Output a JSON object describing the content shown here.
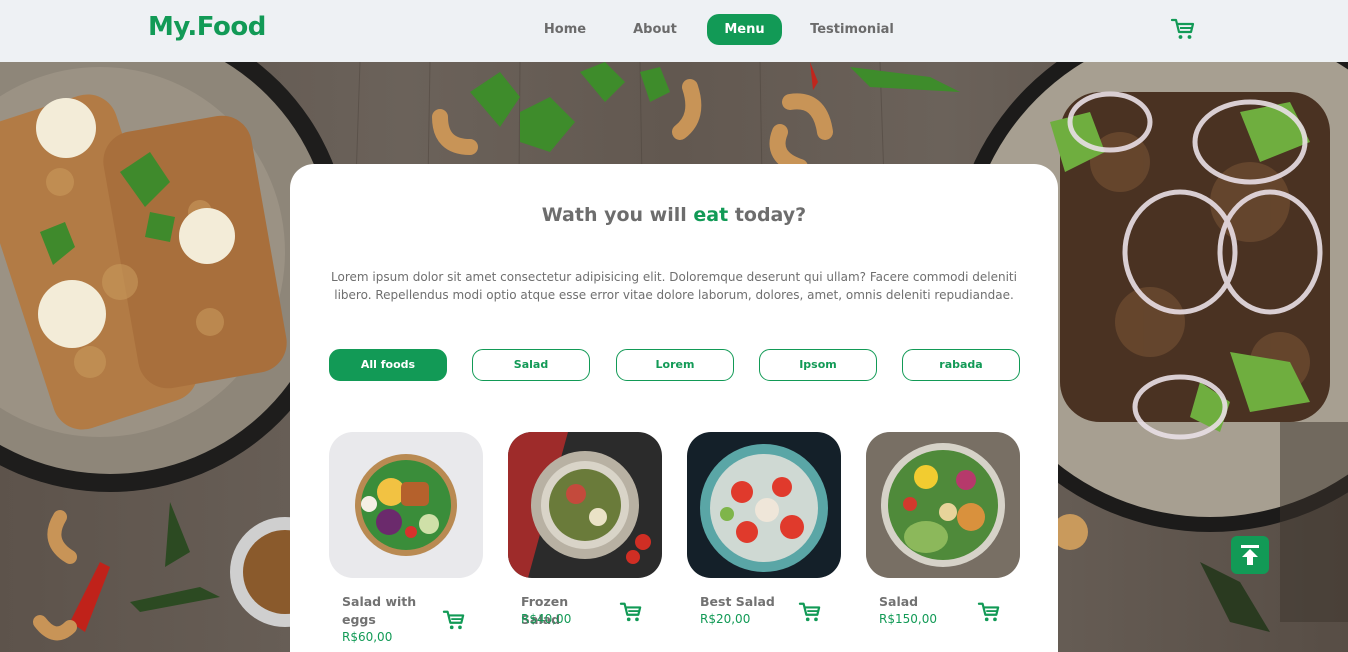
{
  "header": {
    "logo": "My.Food",
    "nav": [
      "Home",
      "About",
      "Menu",
      "Testimonial"
    ],
    "active_nav": "Menu",
    "cart_icon": "cart-icon"
  },
  "main": {
    "headline_pre": "Wath you will ",
    "headline_accent": "eat",
    "headline_post": " today?",
    "intro": "Lorem ipsum dolor sit amet consectetur adipisicing elit. Doloremque deserunt qui ullam? Facere commodi deleniti libero. Repellendus modi optio atque esse error vitae dolore laborum, dolores, amet, omnis deleniti repudiandae.",
    "filters": [
      "All foods",
      "Salad",
      "Lorem",
      "Ipsom",
      "rabada"
    ],
    "active_filter": "All foods",
    "products": [
      {
        "name": "Salad with eggs",
        "price": "R$60,00"
      },
      {
        "name": "Frozen Salad",
        "price": "R$40,00"
      },
      {
        "name": "Best Salad",
        "price": "R$20,00"
      },
      {
        "name": "Salad",
        "price": "R$150,00"
      }
    ]
  },
  "scroll_top_icon": "arrow-up-to-top-icon",
  "colors": {
    "accent": "#129a56",
    "navbar_bg": "#eef1f4",
    "text_gray": "#6d6d6d"
  }
}
